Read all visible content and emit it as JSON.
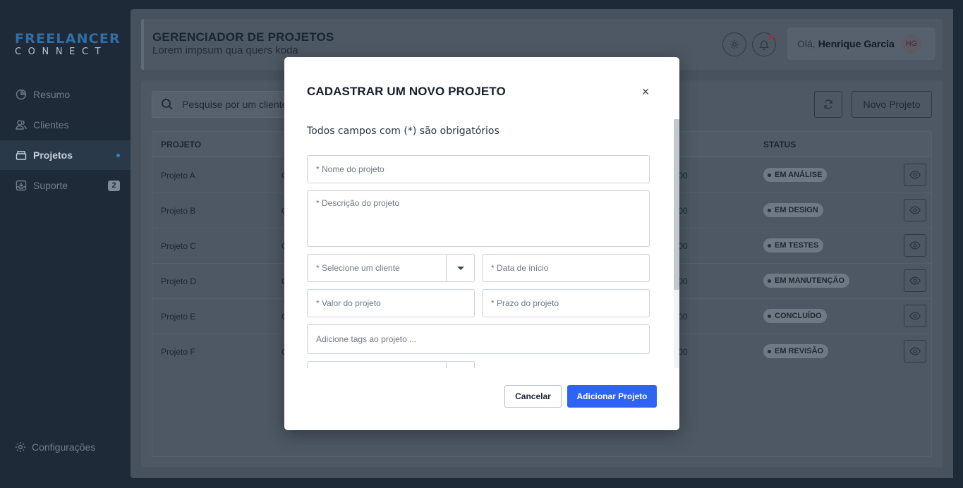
{
  "brand": {
    "line1": "FREELANCER",
    "line2": "CONNECT"
  },
  "sidebar": {
    "items": [
      {
        "label": "Resumo",
        "icon": "pie-chart-icon"
      },
      {
        "label": "Clientes",
        "icon": "users-icon"
      },
      {
        "label": "Projetos",
        "icon": "folder-icon",
        "active": true
      },
      {
        "label": "Suporte",
        "icon": "inbox-icon",
        "badge": "2"
      }
    ],
    "config_label": "Configurações"
  },
  "header": {
    "title": "GERENCIADOR DE PROJETOS",
    "subtitle": "Lorem impsum qua quers koda",
    "greeting": "Olá,",
    "user_name": "Henrique Garcia",
    "user_initials": "HG"
  },
  "toolbar": {
    "search_placeholder": "Pesquise por um cliente",
    "new_project_label": "Novo Projeto"
  },
  "table": {
    "columns": [
      "PROJETO",
      "STATUS"
    ],
    "rows": [
      {
        "project": "Projeto A",
        "client_initial": "C",
        "value_tail": ",00",
        "status": "EM ANÁLISE"
      },
      {
        "project": "Projeto B",
        "client_initial": "C",
        "value_tail": ",00",
        "status": "EM DESIGN"
      },
      {
        "project": "Projeto C",
        "client_initial": "C",
        "value_tail": ",00",
        "status": "EM TESTES"
      },
      {
        "project": "Projeto D",
        "client_initial": "C",
        "value_tail": ",00",
        "status": "EM MANUTENÇÃO"
      },
      {
        "project": "Projeto E",
        "client_initial": "C",
        "value_tail": ",00",
        "status": "CONCLUÍDO"
      },
      {
        "project": "Projeto F",
        "client_initial": "C",
        "value_tail": ",00",
        "status": "EM REVISÃO"
      }
    ]
  },
  "modal": {
    "title": "CADASTRAR UM NOVO PROJETO",
    "close_symbol": "×",
    "required_note": "Todos campos com (*) são obrigatórios",
    "fields": {
      "name": "* Nome do projeto",
      "description": "* Descrição do projeto",
      "client": "* Selecione um cliente",
      "start_date": "* Data de início",
      "value": "* Valor do projeto",
      "deadline": "* Prazo do projeto",
      "tags": "Adicione tags ao projeto ..."
    },
    "cancel_label": "Cancelar",
    "submit_label": "Adicionar Projeto"
  },
  "colors": {
    "sidebar_bg": "#1e2a38",
    "brand_blue": "#2f6fa6",
    "primary_button": "#2f63f5",
    "main_bg_dimmed": "#47525e"
  }
}
